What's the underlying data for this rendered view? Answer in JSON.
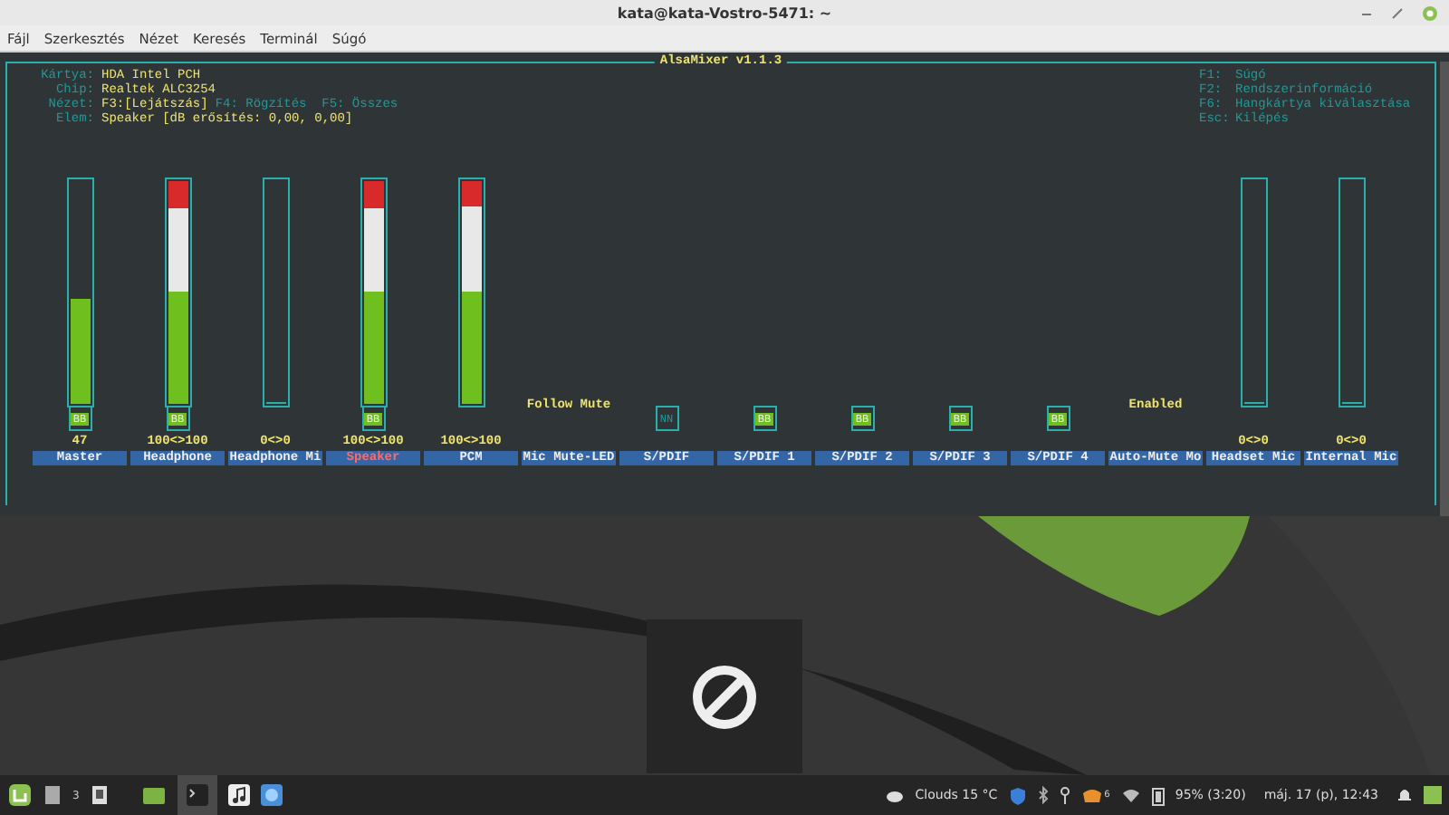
{
  "window": {
    "title": "kata@kata-Vostro-5471: ~"
  },
  "menu": [
    "Fájl",
    "Szerkesztés",
    "Nézet",
    "Keresés",
    "Terminál",
    "Súgó"
  ],
  "mixer": {
    "title": "AlsaMixer v1.1.3",
    "info": [
      {
        "key": "Kártya:",
        "value": "HDA Intel PCH"
      },
      {
        "key": "Chip:",
        "value": "Realtek ALC3254"
      },
      {
        "key": "Nézet:",
        "value": "F3:[Lejátszás]",
        "extra": "F4: Rögzítés  F5: Összes"
      },
      {
        "key": "Elem:",
        "value": "Speaker [dB erősítés: 0,00, 0,00]"
      }
    ],
    "help": [
      {
        "key": "F1:",
        "value": "Súgó"
      },
      {
        "key": "F2:",
        "value": "Rendszerinformáció"
      },
      {
        "key": "F6:",
        "value": "Hangkártya kiválasztása"
      },
      {
        "key": "Esc:",
        "value": "Kilépés"
      }
    ],
    "channels": [
      {
        "kind": "volume",
        "name": "Master",
        "selected": false,
        "level": 0.47,
        "value": "47",
        "mute": "BB",
        "muted": false
      },
      {
        "kind": "volume",
        "name": "Headphone",
        "selected": false,
        "level": 1,
        "value": "100<>100",
        "mute": "BB",
        "muted": false
      },
      {
        "kind": "volume",
        "name": "Headphone Mi",
        "selected": false,
        "level": 0,
        "value": "0<>0"
      },
      {
        "kind": "volume",
        "name": "Speaker",
        "selected": true,
        "level": 1,
        "value": "100<>100",
        "mute": "BB",
        "muted": false
      },
      {
        "kind": "volume",
        "name": "PCM",
        "selected": false,
        "level": 1,
        "value": "100<>100"
      },
      {
        "kind": "enum",
        "name": "Mic Mute-LED",
        "selected": false,
        "value": "Follow Mute"
      },
      {
        "kind": "switch",
        "name": "S/PDIF",
        "selected": false,
        "mute": "NN",
        "muted": true
      },
      {
        "kind": "switch",
        "name": "S/PDIF 1",
        "selected": false,
        "mute": "BB",
        "muted": false
      },
      {
        "kind": "switch",
        "name": "S/PDIF 2",
        "selected": false,
        "mute": "BB",
        "muted": false
      },
      {
        "kind": "switch",
        "name": "S/PDIF 3",
        "selected": false,
        "mute": "BB",
        "muted": false
      },
      {
        "kind": "switch",
        "name": "S/PDIF 4",
        "selected": false,
        "mute": "BB",
        "muted": false
      },
      {
        "kind": "enum",
        "name": "Auto-Mute Mo",
        "selected": false,
        "value": "Enabled"
      },
      {
        "kind": "volume",
        "name": "Headset Mic",
        "selected": false,
        "level": 0,
        "value": "0<>0"
      },
      {
        "kind": "volume",
        "name": "Internal Mic",
        "selected": false,
        "level": 0,
        "value": "0<>0"
      }
    ]
  },
  "taskbar": {
    "workspace": "3",
    "weather": "Clouds 15 °C",
    "notification_count": "6",
    "battery": "95% (3:20)",
    "clock": "máj. 17 (p), 12:43"
  }
}
